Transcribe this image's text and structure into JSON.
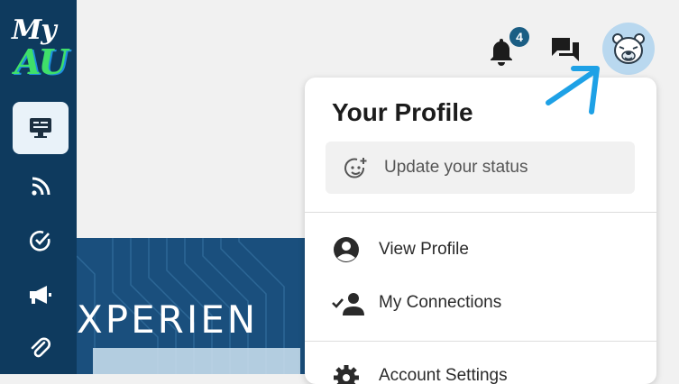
{
  "sidebar": {
    "logo": {
      "line1": "My",
      "line2": "AU"
    },
    "items": [
      {
        "icon": "monitor-icon",
        "active": true
      },
      {
        "icon": "rss-feed-icon",
        "active": false
      },
      {
        "icon": "check-circle-icon",
        "active": false
      },
      {
        "icon": "megaphone-icon",
        "active": false
      },
      {
        "icon": "paperclip-icon",
        "active": false
      }
    ]
  },
  "banner": {
    "text": "XPERIEN"
  },
  "header": {
    "notifications": {
      "icon": "bell-icon",
      "count": "4"
    },
    "messages": {
      "icon": "chat-icon"
    },
    "avatar": {
      "icon": "bear-mascot-icon"
    }
  },
  "profile_menu": {
    "title": "Your Profile",
    "status_placeholder": "Update your status",
    "items": [
      {
        "icon": "account-circle-icon",
        "label": "View Profile"
      },
      {
        "icon": "connections-icon",
        "label": "My Connections"
      },
      {
        "icon": "gear-icon",
        "label": "Account Settings"
      }
    ]
  },
  "colors": {
    "sidebar": "#0e3a5e",
    "accent": "#1b5e84",
    "arrow": "#1ea1e6"
  }
}
